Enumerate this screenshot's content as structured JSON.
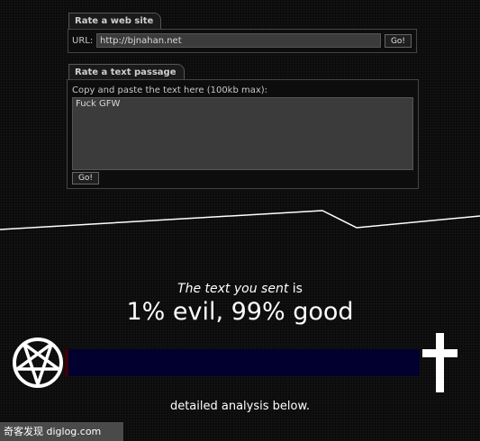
{
  "web_form": {
    "tab_label": "Rate a web site",
    "url_label": "URL:",
    "url_value": "http://bjnahan.net",
    "go_label": "Go!"
  },
  "text_form": {
    "tab_label": "Rate a text passage",
    "instructions": "Copy and paste the text here (100kb max):",
    "text_value": "Fuck GFW",
    "go_label": "Go!"
  },
  "result": {
    "source_label": "The text you sent",
    "is_word": "is",
    "verdict": "1% evil, 99% good",
    "evil_percent": 1,
    "good_percent": 99,
    "detail_text": "detailed analysis below."
  },
  "icons": {
    "left": "pentagram-icon",
    "right": "cross-icon"
  },
  "colors": {
    "evil": "#3a0005",
    "good": "#01002e",
    "background": "#0b0b0b"
  },
  "footer": {
    "watermark": "奇客发现 diglog.com"
  }
}
